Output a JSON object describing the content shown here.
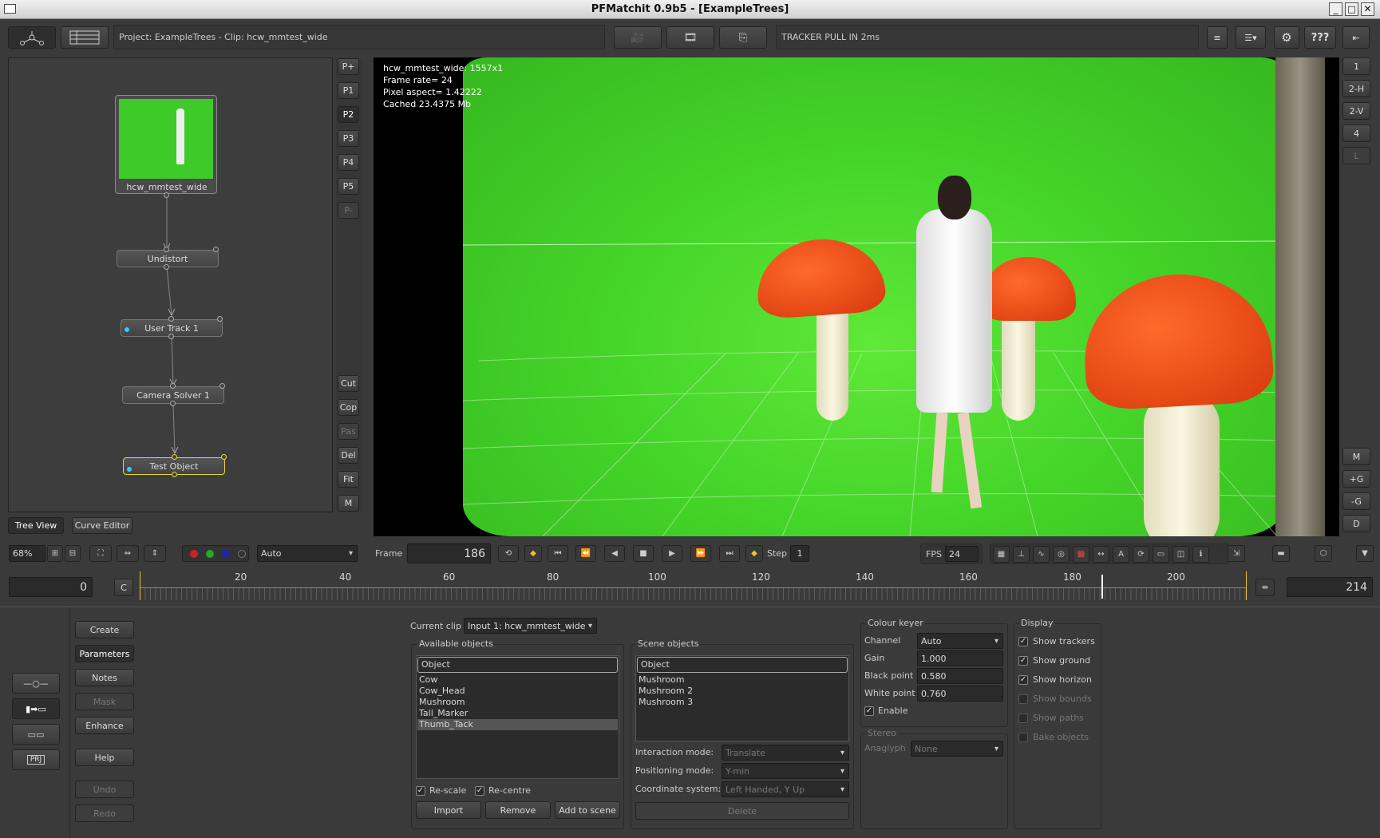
{
  "window": {
    "title": "PFMatchit 0.9b5 - [ExampleTrees]"
  },
  "topbar": {
    "project_info": "Project: ExampleTrees - Clip: hcw_mmtest_wide",
    "status": "TRACKER PULL IN 2ms",
    "help_label": "???"
  },
  "side_left_buttons": [
    "P+",
    "P1",
    "P2",
    "P3",
    "P4",
    "P5",
    "P-",
    "Cut",
    "Cop",
    "Pas",
    "Del",
    "Fit",
    "M"
  ],
  "side_right_buttons": [
    "1",
    "2-H",
    "2-V",
    "4",
    "L",
    "M",
    "+G",
    "-G",
    "D"
  ],
  "tree": {
    "nodes": [
      "hcw_mmtest_wide",
      "Undistort",
      "User Track 1",
      "Camera Solver 1",
      "Test Object"
    ],
    "tab_tree": "Tree View",
    "tab_curve": "Curve Editor"
  },
  "viewer": {
    "info_lines": [
      "hcw_mmtest_wide: 1557x1",
      "Frame rate= 24",
      "Pixel aspect= 1.42222",
      "Cached 23.4375 Mb"
    ]
  },
  "controls": {
    "zoom": "68%",
    "channel": "Auto",
    "frame_label": "Frame",
    "frame_value": "186",
    "step_label": "Step",
    "step_value": "1",
    "fps_label": "FPS",
    "fps_value": "24"
  },
  "timeline": {
    "start": "0",
    "end": "214",
    "c_label": "C",
    "ticks": [
      "20",
      "40",
      "60",
      "80",
      "100",
      "120",
      "140",
      "160",
      "180",
      "200"
    ],
    "current_frame_fraction": 0.869
  },
  "left_menu": [
    "Create",
    "Parameters",
    "Notes",
    "Mask",
    "Enhance",
    "Help",
    "Undo",
    "Redo"
  ],
  "prj_label": "PRJ",
  "params": {
    "current_clip_label": "Current clip",
    "current_clip_value": "Input 1: hcw_mmtest_wide",
    "available_title": "Available objects",
    "available_header": "Object",
    "available_items": [
      "Cow",
      "Cow_Head",
      "Mushroom",
      "Tall_Marker",
      "Thumb_Tack"
    ],
    "available_selected": "Thumb_Tack",
    "rescale": "Re-scale",
    "recentre": "Re-centre",
    "import": "Import",
    "remove": "Remove",
    "add_to_scene": "Add to scene",
    "scene_title": "Scene objects",
    "scene_header": "Object",
    "scene_items": [
      "Mushroom",
      "Mushroom 2",
      "Mushroom 3"
    ],
    "interaction_label": "Interaction mode:",
    "interaction_value": "Translate",
    "positioning_label": "Positioning mode:",
    "positioning_value": "Y-min",
    "coord_label": "Coordinate system:",
    "coord_value": "Left Handed, Y Up",
    "delete": "Delete"
  },
  "keyer": {
    "title": "Colour keyer",
    "channel_label": "Channel",
    "channel_value": "Auto",
    "gain_label": "Gain",
    "gain_value": "1.000",
    "black_label": "Black point",
    "black_value": "0.580",
    "white_label": "White point",
    "white_value": "0.760",
    "enable": "Enable",
    "stereo_title": "Stereo",
    "anaglyph_label": "Anaglyph",
    "anaglyph_value": "None"
  },
  "display": {
    "title": "Display",
    "items": [
      {
        "label": "Show trackers",
        "checked": true,
        "enabled": true
      },
      {
        "label": "Show ground",
        "checked": true,
        "enabled": true
      },
      {
        "label": "Show horizon",
        "checked": true,
        "enabled": true
      },
      {
        "label": "Show bounds",
        "checked": false,
        "enabled": false
      },
      {
        "label": "Show paths",
        "checked": false,
        "enabled": false
      },
      {
        "label": "Bake objects",
        "checked": false,
        "enabled": false
      }
    ]
  }
}
